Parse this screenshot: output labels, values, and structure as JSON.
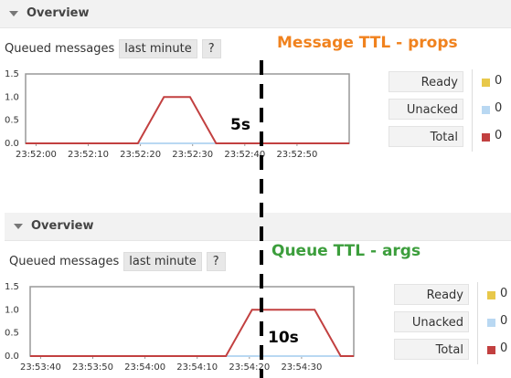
{
  "panels": [
    {
      "header": "Overview",
      "queued_label": "Queued messages",
      "range_label": "last minute",
      "help_label": "?",
      "annotation": "Message TTL - props",
      "duration_label": "5s",
      "stats": [
        {
          "label": "Ready",
          "value": "0",
          "color": "#e8c84a"
        },
        {
          "label": "Unacked",
          "value": "0",
          "color": "#b9d8f2"
        },
        {
          "label": "Total",
          "value": "0",
          "color": "#c24040"
        }
      ],
      "chart_data": {
        "type": "line",
        "y_ticks": [
          "1.5",
          "1.0",
          "0.5",
          "0.0"
        ],
        "ylim": [
          0,
          1.5
        ],
        "x_ticks": [
          "23:52:00",
          "23:52:10",
          "23:52:20",
          "23:52:30",
          "23:52:40",
          "23:52:50"
        ],
        "series": [
          {
            "color": "#b9d8f2",
            "x": [
              0,
              10,
              20,
              25,
              35,
              40,
              60
            ],
            "values": [
              0,
              0,
              0,
              0,
              0,
              0,
              0
            ]
          },
          {
            "color": "#c24040",
            "x": [
              -2,
              19.5,
              24.5,
              29.5,
              34.5,
              60
            ],
            "values": [
              0,
              0,
              1,
              1,
              0,
              0
            ]
          }
        ],
        "xrange": [
          -2,
          60
        ]
      }
    },
    {
      "header": "Overview",
      "queued_label": "Queued messages",
      "range_label": "last minute",
      "help_label": "?",
      "annotation": "Queue TTL - args",
      "duration_label": "10s",
      "stats": [
        {
          "label": "Ready",
          "value": "0",
          "color": "#e8c84a"
        },
        {
          "label": "Unacked",
          "value": "0",
          "color": "#b9d8f2"
        },
        {
          "label": "Total",
          "value": "0",
          "color": "#c24040"
        }
      ],
      "chart_data": {
        "type": "line",
        "y_ticks": [
          "1.5",
          "1.0",
          "0.5",
          "0.0"
        ],
        "ylim": [
          0,
          1.5
        ],
        "x_ticks": [
          "23:53:40",
          "23:53:50",
          "23:54:00",
          "23:54:10",
          "23:54:20",
          "23:54:30"
        ],
        "series": [
          {
            "color": "#b9d8f2",
            "x": [
              -2,
              60
            ],
            "values": [
              0,
              0
            ]
          },
          {
            "color": "#c24040",
            "x": [
              -2,
              35.5,
              40.5,
              52.5,
              57.5,
              60
            ],
            "values": [
              0,
              0,
              1,
              1,
              0,
              0
            ]
          }
        ],
        "xrange": [
          -2,
          60
        ]
      }
    }
  ]
}
